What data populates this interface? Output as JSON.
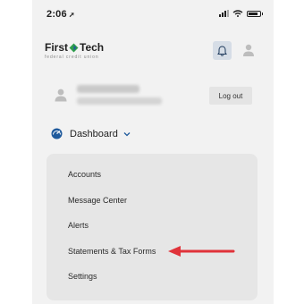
{
  "status_bar": {
    "time": "2:06",
    "location_glyph": "➚"
  },
  "logo": {
    "name_part1": "First",
    "name_part2": "Tech",
    "tagline": "federal credit union"
  },
  "header": {
    "bell_icon": "bell-icon",
    "profile_icon": "person-icon"
  },
  "user": {
    "logout_label": "Log out"
  },
  "nav": {
    "dashboard_label": "Dashboard"
  },
  "menu": {
    "items": [
      {
        "label": "Accounts"
      },
      {
        "label": "Message Center"
      },
      {
        "label": "Alerts"
      },
      {
        "label": "Statements & Tax Forms"
      },
      {
        "label": "Settings"
      }
    ]
  },
  "colors": {
    "accent_blue": "#1f5a9c",
    "annotation_arrow": "#e0333a",
    "bell_bg": "#d6dde6"
  }
}
